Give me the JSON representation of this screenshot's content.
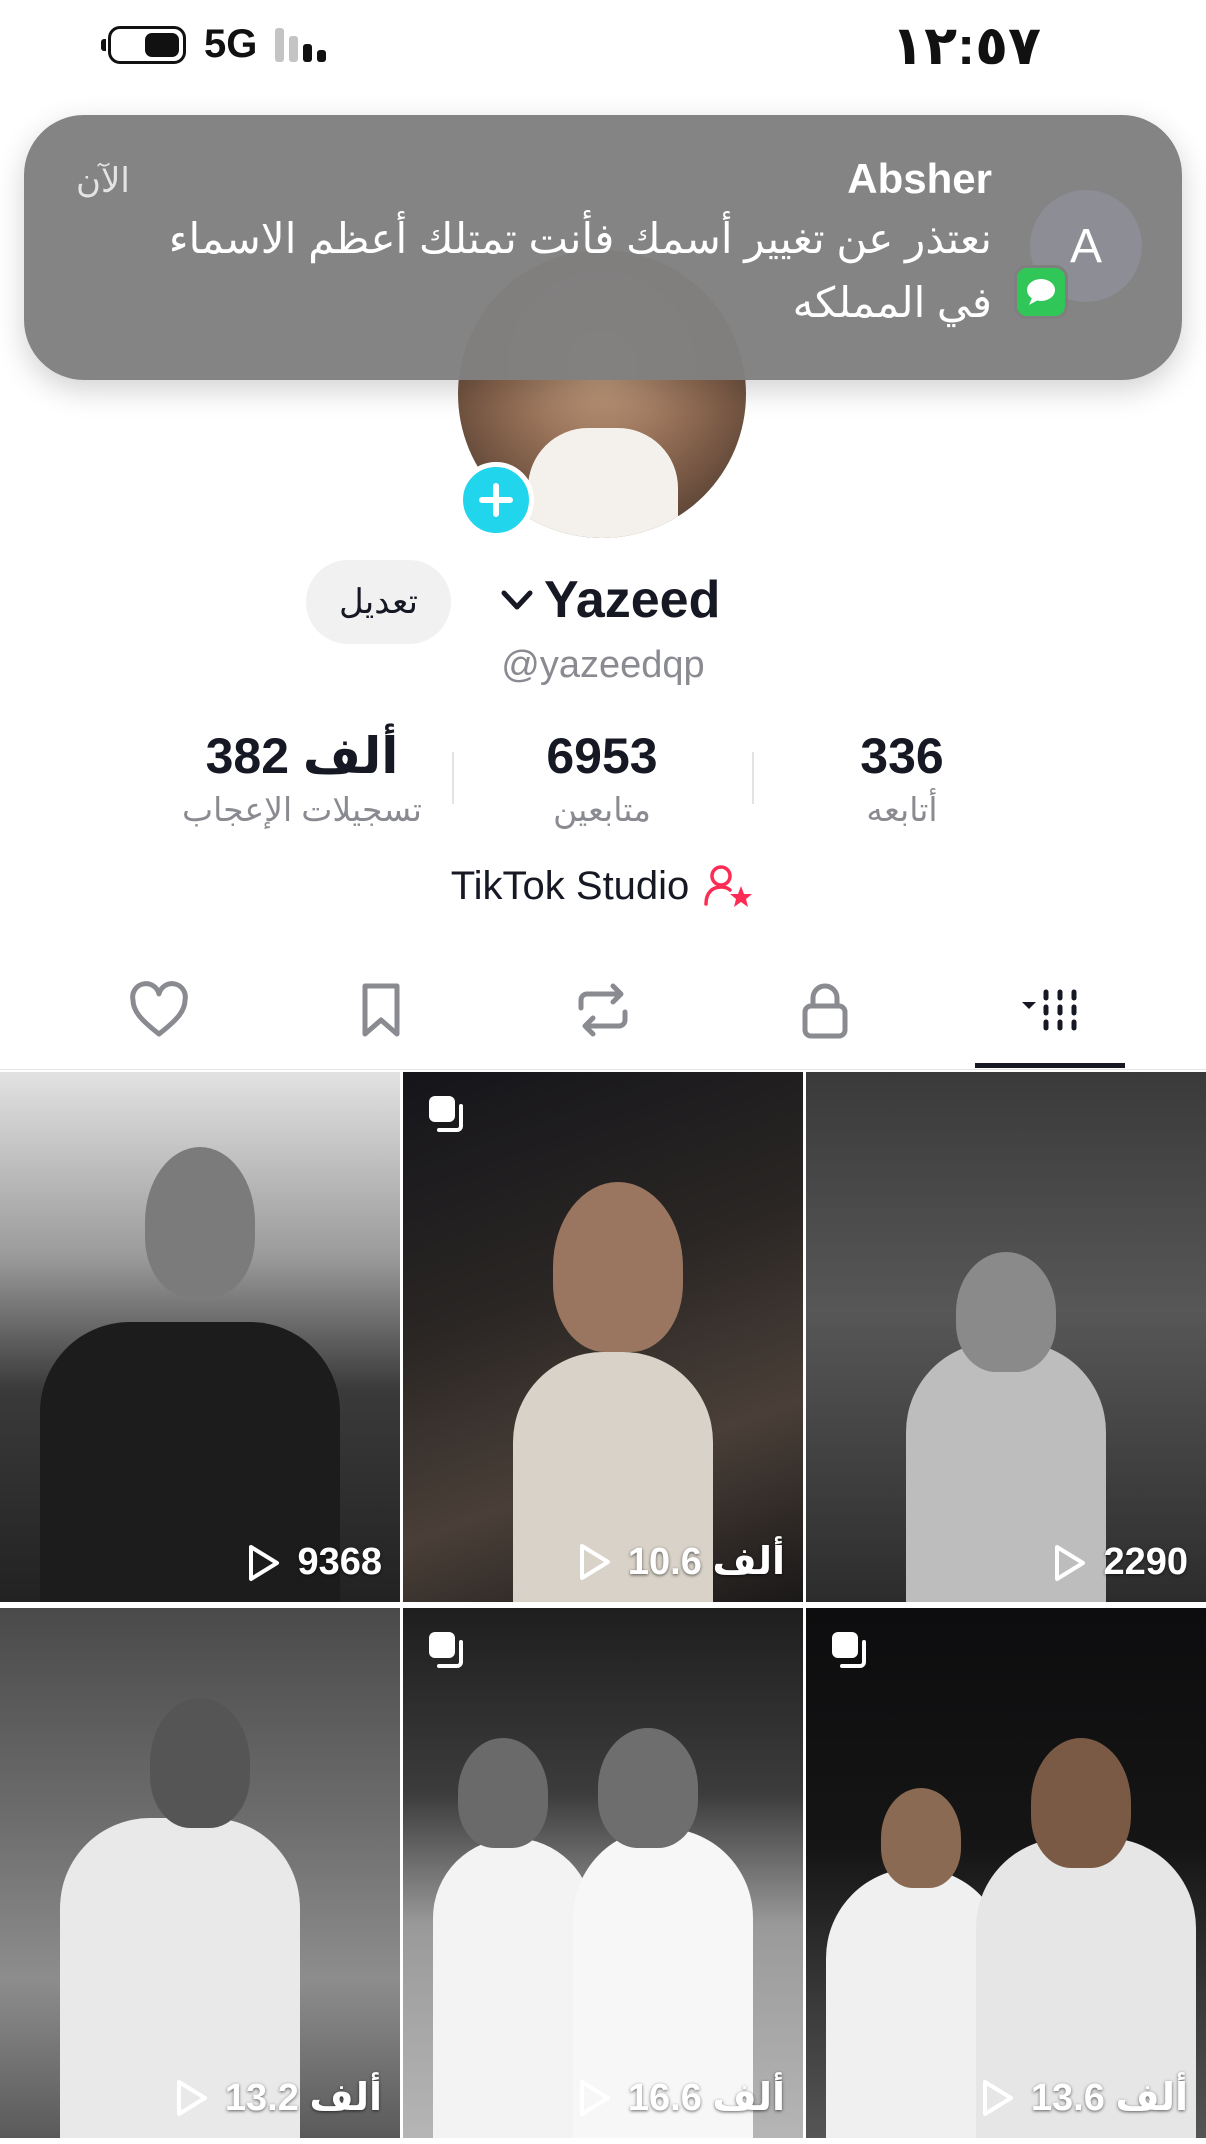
{
  "status_bar": {
    "network": "5G",
    "time": "١٢:٥٧"
  },
  "notification": {
    "app": "Absher",
    "sender_initial": "A",
    "time": "الآن",
    "message": "نعتذر عن تغيير أسمك فأنت تمتلك أعظم الاسماء في المملكه",
    "badge_icon": "messages-icon"
  },
  "profile": {
    "display_name": "Yazeed",
    "username": "@yazeedqp",
    "edit_label": "تعديل",
    "stats": [
      {
        "value": "336",
        "label": "أتابعه"
      },
      {
        "value": "6953",
        "label": "متابعين"
      },
      {
        "value": "382 ألف",
        "label": "تسجيلات الإعجاب"
      }
    ],
    "studio_label": "TikTok Studio",
    "studio_icon": "creator-star-icon"
  },
  "tabs": [
    {
      "name": "videos",
      "icon": "grid-icon",
      "active": true
    },
    {
      "name": "private",
      "icon": "lock-icon"
    },
    {
      "name": "reposts",
      "icon": "repost-icon"
    },
    {
      "name": "favorites",
      "icon": "bookmark-icon"
    },
    {
      "name": "liked",
      "icon": "heart-icon"
    }
  ],
  "videos": [
    {
      "views": "2290",
      "multi": false
    },
    {
      "views": "10.6 ألف",
      "multi": true
    },
    {
      "views": "9368",
      "multi": false
    },
    {
      "views": "13.6 ألف",
      "multi": true
    },
    {
      "views": "16.6 ألف",
      "multi": true
    },
    {
      "views": "13.2 ألف",
      "multi": false
    }
  ],
  "colors": {
    "accent_cyan": "#20d5ec",
    "accent_pink": "#fe2c55",
    "text_primary": "#161823",
    "text_secondary": "#8a8b91"
  }
}
